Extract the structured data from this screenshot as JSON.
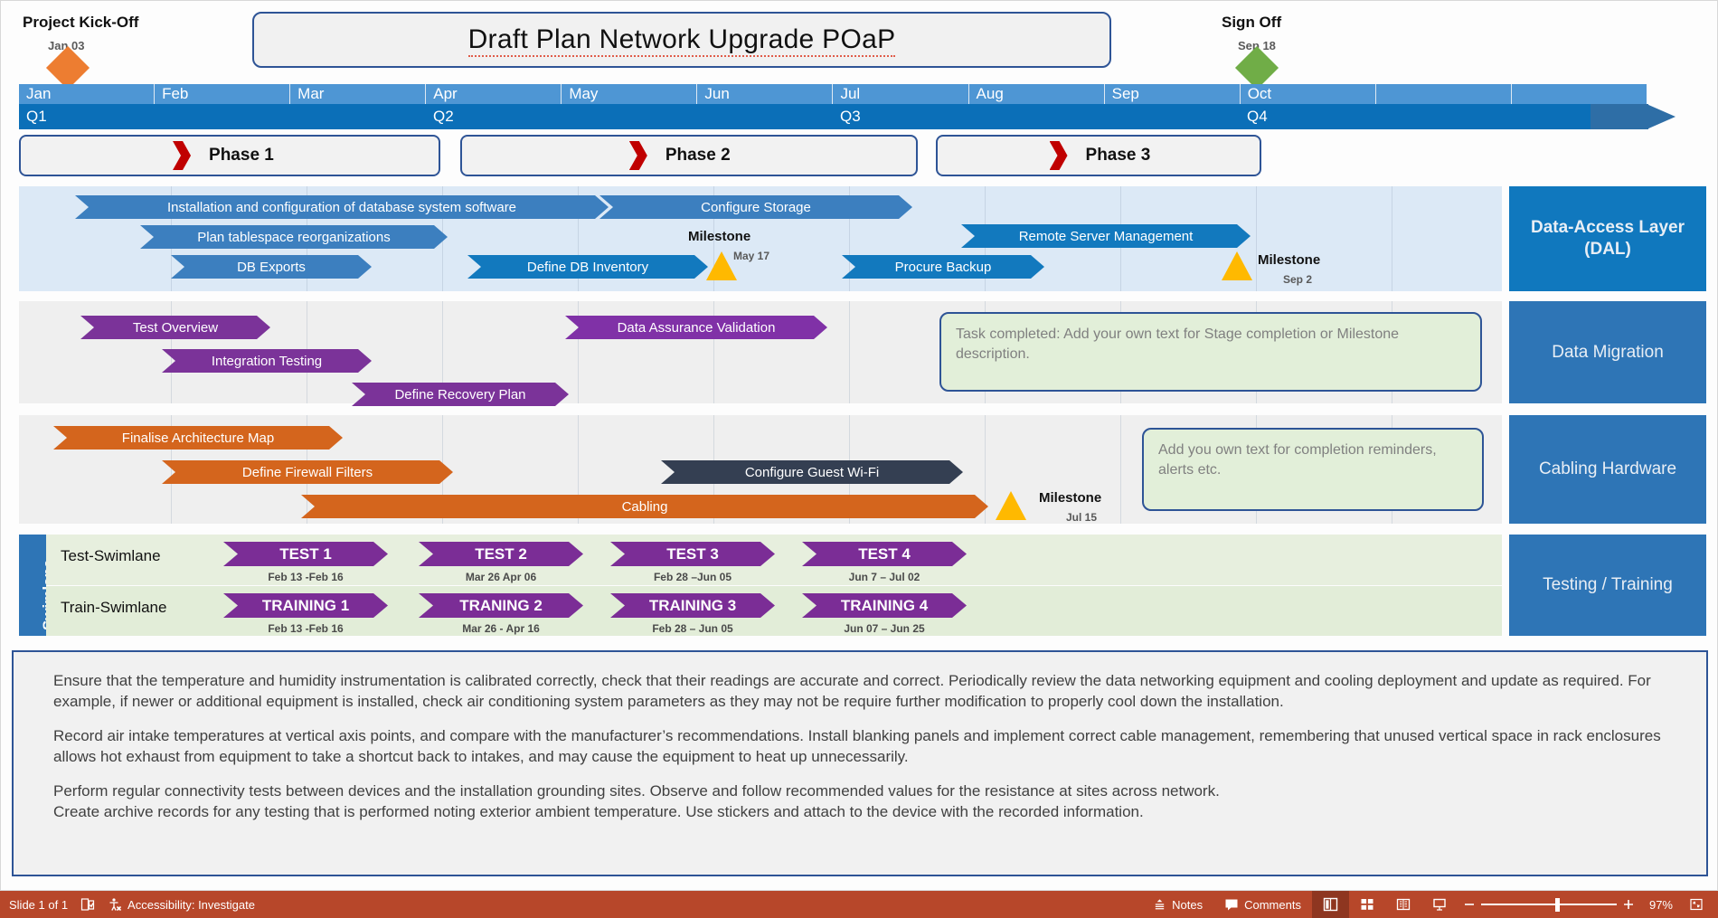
{
  "header": {
    "kickoff": {
      "label": "Project Kick-Off",
      "date": "Jan 03",
      "color": "#ED7D31"
    },
    "signoff": {
      "label": "Sign Off",
      "date": "Sep 18",
      "color": "#70AD47"
    },
    "title": "Draft Plan Network Upgrade POaP"
  },
  "timeline": {
    "months": [
      "Jan",
      "Feb",
      "Mar",
      "Apr",
      "May",
      "Jun",
      "Jul",
      "Aug",
      "Sep",
      "Oct",
      "",
      ""
    ],
    "quarters": [
      "Q1",
      "Q2",
      "Q3",
      "Q4"
    ]
  },
  "phases": [
    {
      "label": "Phase 1"
    },
    {
      "label": "Phase 2"
    },
    {
      "label": "Phase 3"
    }
  ],
  "rows": [
    {
      "name": "Data-Access Layer (DAL)",
      "bars": [
        {
          "label": "Installation and configuration of database system software",
          "color": "#3C7FBF"
        },
        {
          "label": "Configure Storage",
          "color": "#3C7FBF"
        },
        {
          "label": "Plan tablespace reorganizations",
          "color": "#3C7FBF"
        },
        {
          "label": "Remote Server Management",
          "color": "#1279BE"
        },
        {
          "label": "DB Exports",
          "color": "#3C7FBF"
        },
        {
          "label": "Define DB Inventory",
          "color": "#1279BE"
        },
        {
          "label": "Procure Backup",
          "color": "#1279BE"
        }
      ],
      "milestones": [
        {
          "label": "Milestone",
          "date": "May 17",
          "color": "#FFB900"
        },
        {
          "label": "Milestone",
          "date": "Sep 2",
          "color": "#FFB900"
        }
      ]
    },
    {
      "name": "Data Migration",
      "bars": [
        {
          "label": "Test Overview",
          "color": "#7B3399"
        },
        {
          "label": "Data Assurance Validation",
          "color": "#8031A7"
        },
        {
          "label": "Integration Testing",
          "color": "#7B3399"
        },
        {
          "label": "Define Recovery Plan",
          "color": "#7B3399"
        }
      ],
      "note": "Task completed: Add your own text for Stage completion or Milestone description."
    },
    {
      "name": "Cabling Hardware",
      "bars": [
        {
          "label": "Finalise Architecture Map",
          "color": "#D4651D"
        },
        {
          "label": "Define Firewall Filters",
          "color": "#D4651D"
        },
        {
          "label": "Configure Guest Wi-Fi",
          "color": "#343F52"
        },
        {
          "label": "Cabling",
          "color": "#D4651D"
        }
      ],
      "milestones": [
        {
          "label": "Milestone",
          "date": "Jul 15",
          "color": "#FFB900"
        }
      ],
      "note": "Add you own text for completion reminders, alerts etc."
    },
    {
      "name": "Testing / Training"
    }
  ],
  "swimlane": {
    "vertical_label": "Swimlane",
    "lanes": [
      {
        "name": "Test-Swimlane",
        "items": [
          {
            "label": "TEST 1",
            "date": "Feb 13 -Feb 16"
          },
          {
            "label": "TEST 2",
            "date": "Mar 26 Apr 06"
          },
          {
            "label": "TEST 3",
            "date": "Feb 28 –Jun 05"
          },
          {
            "label": "TEST 4",
            "date": "Jun 7 – Jul 02"
          }
        ]
      },
      {
        "name": "Train-Swimlane",
        "items": [
          {
            "label": "TRAINING 1",
            "date": "Feb 13 -Feb 16"
          },
          {
            "label": "TRANING 2",
            "date": "Mar 26 - Apr 16"
          },
          {
            "label": "TRAINING 3",
            "date": "Feb 28 – Jun 05"
          },
          {
            "label": "TRAINING 4",
            "date": "Jun 07 – Jun 25"
          }
        ]
      }
    ]
  },
  "notes_box": {
    "paragraphs": [
      "Ensure that the temperature and humidity instrumentation is calibrated correctly, check that their readings are accurate and correct. Periodically review the data networking equipment and cooling deployment and update as required. For example, if newer or additional equipment is installed, check air conditioning system parameters as they may not be require further modification to properly cool down the installation.",
      "Record air intake temperatures at vertical axis points, and compare with the manufacturer’s recommendations. Install blanking panels and implement correct cable management, remembering that unused vertical space in rack enclosures allows hot exhaust from equipment to take a shortcut back to intakes, and may cause the equipment to heat up unnecessarily.",
      "Perform regular connectivity tests between devices and the installation grounding sites. Observe and follow recommended values for the resistance at sites across network.\nCreate archive records for any testing that is performed noting exterior ambient temperature. Use stickers and attach to the device with the recorded information."
    ]
  },
  "statusbar": {
    "slide_count": "Slide 1 of 1",
    "accessibility": "Accessibility: Investigate",
    "notes": "Notes",
    "comments": "Comments",
    "zoom_percent": "97%",
    "bg_color": "#B7472A"
  }
}
